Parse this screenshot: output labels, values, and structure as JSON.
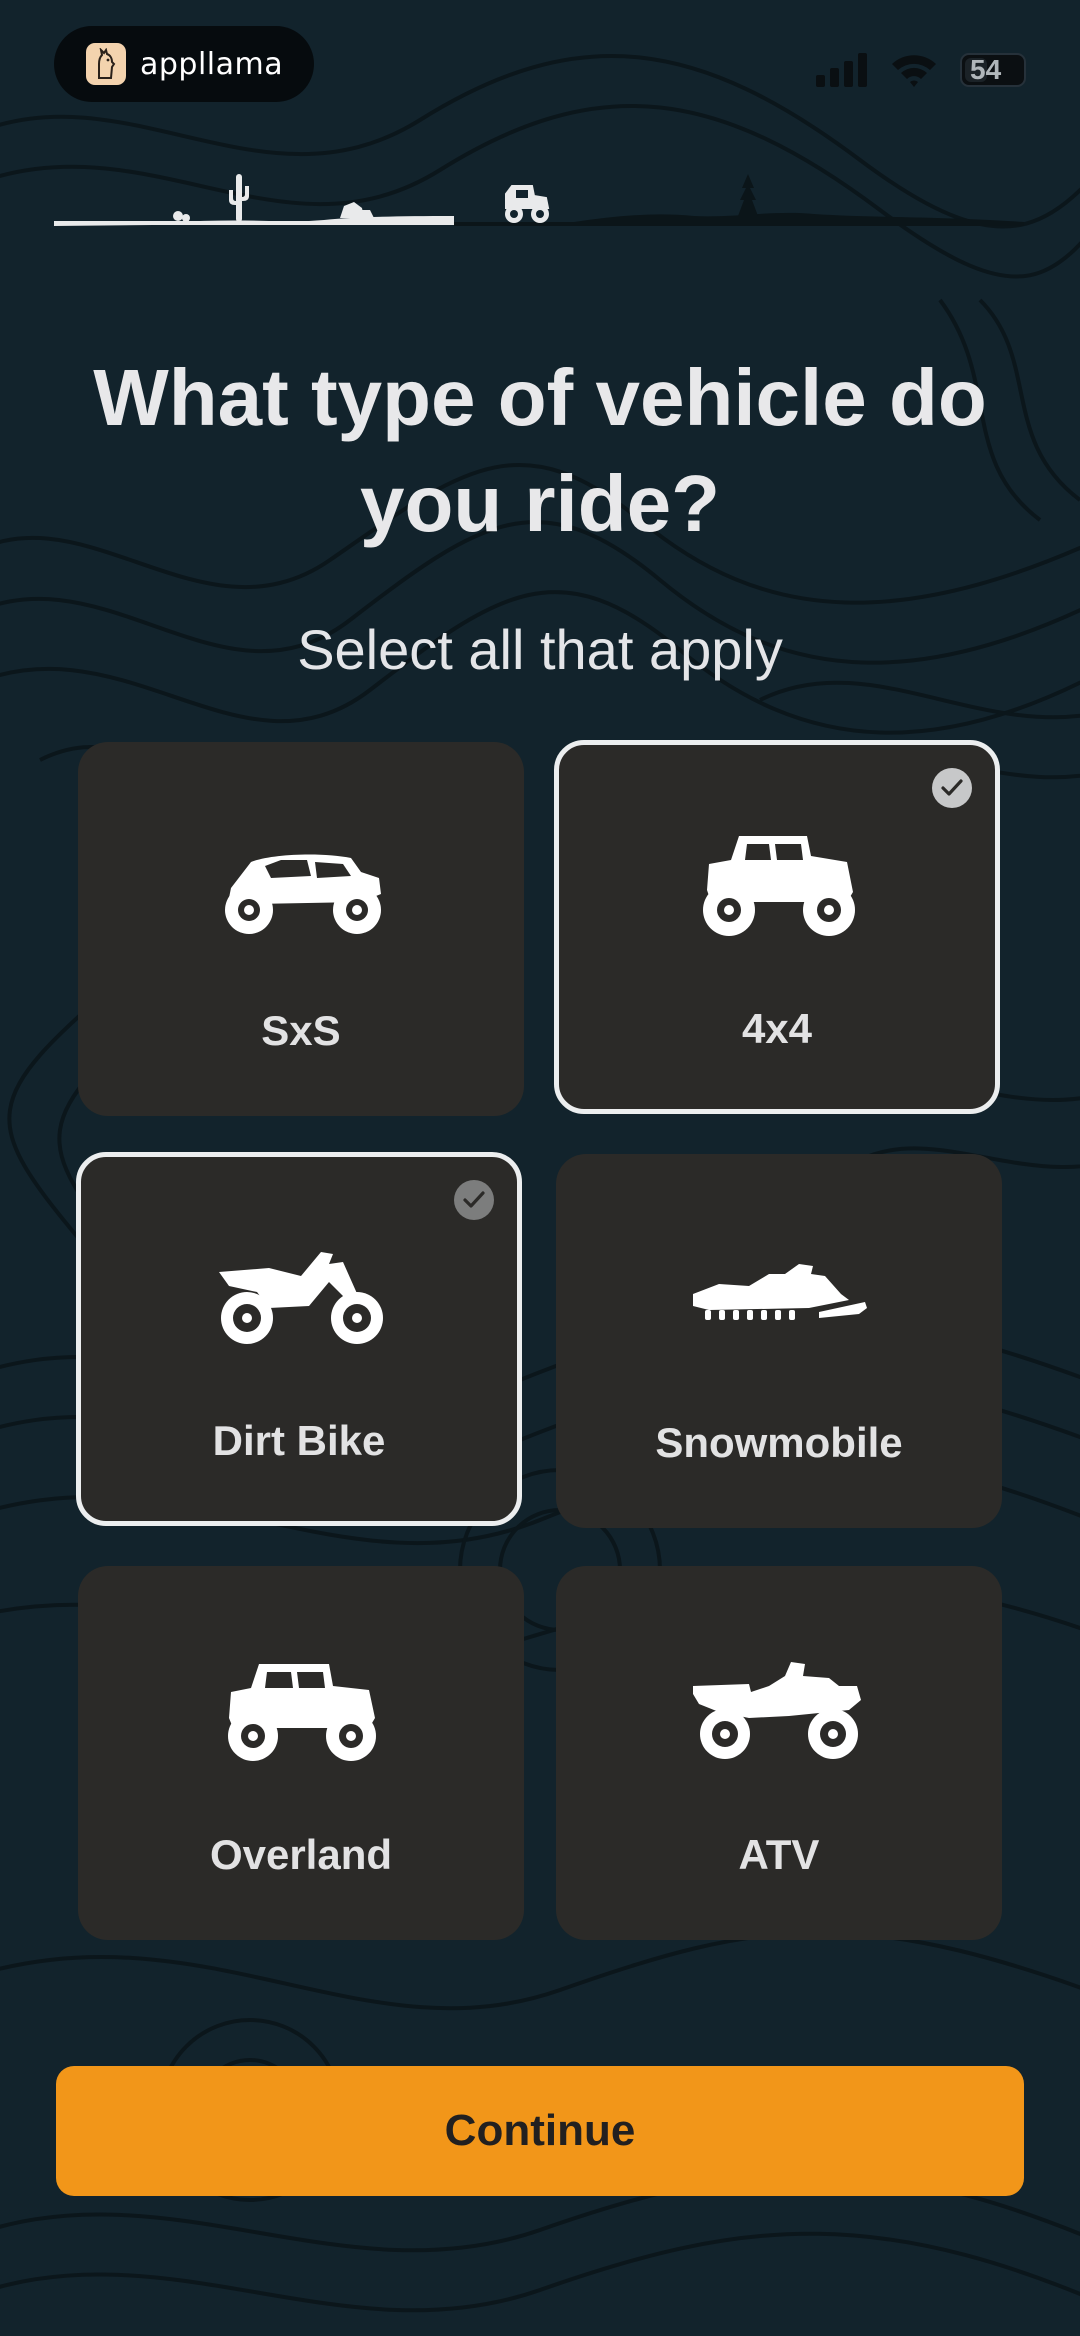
{
  "status_bar": {
    "brand_name": "appllama",
    "battery": "54",
    "icons": [
      "signal-icon",
      "wifi-icon",
      "battery-icon"
    ]
  },
  "progress": {
    "icons": [
      "cactus-icon",
      "rocks-icon",
      "jeep-icon",
      "pine-tree-icon"
    ]
  },
  "heading": {
    "title": "What type of vehicle do you ride?",
    "subtitle": "Select all that apply"
  },
  "options": [
    {
      "label": "SxS",
      "icon": "sxs-icon",
      "selected": false
    },
    {
      "label": "4x4",
      "icon": "4x4-icon",
      "selected": true
    },
    {
      "label": "Dirt Bike",
      "icon": "dirt-bike-icon",
      "selected": true
    },
    {
      "label": "Snowmobile",
      "icon": "snowmobile-icon",
      "selected": false
    },
    {
      "label": "Overland",
      "icon": "overland-icon",
      "selected": false
    },
    {
      "label": "ATV",
      "icon": "atv-icon",
      "selected": false
    }
  ],
  "continue_label": "Continue",
  "colors": {
    "background": "#12232c",
    "card": "#2b2a28",
    "accent": "#f29619",
    "text": "#e8e8ea"
  }
}
